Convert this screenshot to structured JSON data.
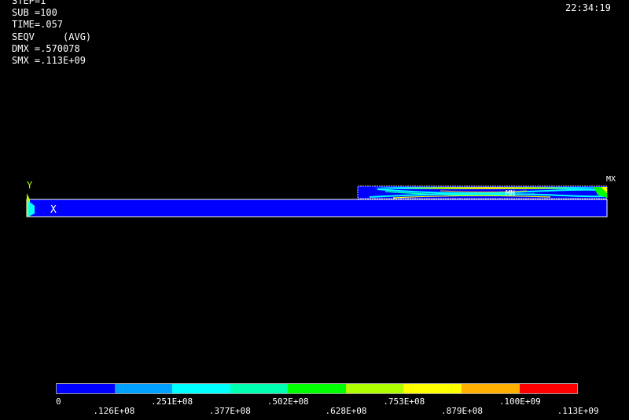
{
  "header": {
    "step": "STEP=1",
    "sub": "SUB =100",
    "time": "TIME=.057",
    "seqv": "SEQV     (AVG)",
    "dmx": "DMX =.570078",
    "smx": "SMX =.113E+09",
    "clock": "22:34:19"
  },
  "model": {
    "axis_y": "Y",
    "axis_x": "X",
    "max_label": "MX",
    "min_label": "MN"
  },
  "legend": {
    "colors": [
      "#0000ff",
      "#00a0ff",
      "#00ffff",
      "#00ffb0",
      "#00ff00",
      "#b0ff00",
      "#ffff00",
      "#ffb000",
      "#ff0000"
    ],
    "ticks": [
      "0",
      ".126E+08",
      ".251E+08",
      ".377E+08",
      ".502E+08",
      ".628E+08",
      ".753E+08",
      ".879E+08",
      ".100E+09",
      ".113E+09"
    ]
  }
}
